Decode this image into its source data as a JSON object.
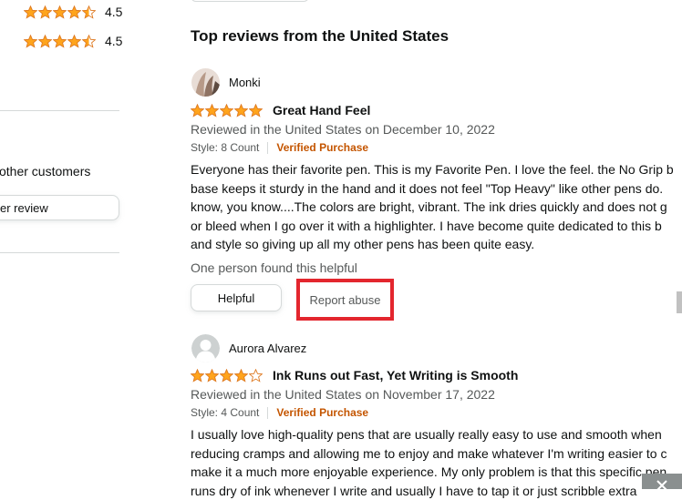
{
  "sidebar": {
    "ratings": [
      {
        "label": "4.5",
        "stars": 4.5
      },
      {
        "label": "4.5",
        "stars": 4.5
      }
    ],
    "share_text": "other customers",
    "write_review_label": "er review"
  },
  "reviews_section": {
    "title": "Top reviews from the United States"
  },
  "reviews": [
    {
      "reviewer": "Monki",
      "stars": 5,
      "title": "Great Hand Feel",
      "meta": "Reviewed in the United States on December 10, 2022",
      "style": "Style: 8 Count",
      "verified": "Verified Purchase",
      "body_lines": [
        "Everyone has their favorite pen. This is my Favorite Pen. I love the feel. the No Grip b",
        "base keeps it sturdy in the hand and it does not feel \"Top Heavy\" like other pens do.",
        "know, you know....The colors are bright, vibrant. The ink dries quickly and does not g",
        "or bleed when I go over it with a highlighter. I have become quite dedicated to this b",
        "and style so giving up all my other pens has been quite easy."
      ],
      "helpful_count": "One person found this helpful",
      "helpful_label": "Helpful",
      "report_label": "Report abuse"
    },
    {
      "reviewer": "Aurora Alvarez",
      "stars": 4,
      "title": "Ink Runs out Fast, Yet Writing is Smooth",
      "meta": "Reviewed in the United States on November 17, 2022",
      "style": "Style: 4 Count",
      "verified": "Verified Purchase",
      "body_lines": [
        "I usually love high-quality pens that are usually really easy to use and smooth when",
        "reducing cramps and allowing me to enjoy and make whatever I'm writing easier to c",
        "make it a much more enjoyable experience. My only problem is that this specific pen",
        "runs dry of ink whenever I write and usually I have to tap it or just scribble extra"
      ]
    }
  ],
  "colors": {
    "star": "#ffa41c",
    "verified": "#c45500",
    "highlight_border": "#e3262e"
  }
}
